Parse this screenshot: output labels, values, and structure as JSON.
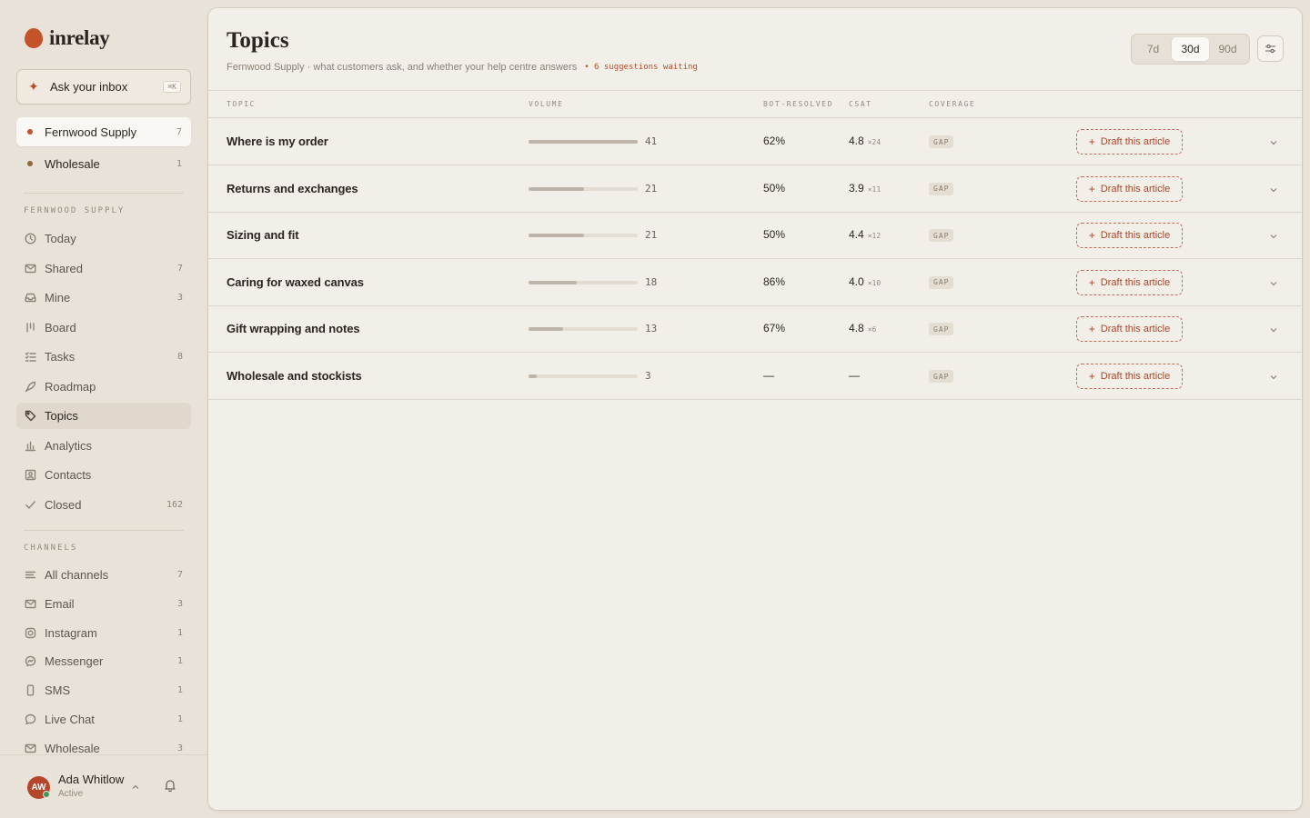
{
  "app": {
    "name": "inrelay"
  },
  "ask": {
    "label": "Ask your inbox",
    "shortcut": "⌘K"
  },
  "workspaces": [
    {
      "label": "Fernwood Supply",
      "count": "7",
      "color": "#c4532a",
      "active": true
    },
    {
      "label": "Wholesale",
      "count": "1",
      "color": "#8a6a3a",
      "active": false
    }
  ],
  "nav_section": "FERNWOOD SUPPLY",
  "nav": [
    {
      "label": "Today",
      "count": "",
      "icon": "clock-icon"
    },
    {
      "label": "Shared",
      "count": "7",
      "icon": "inbox-icon"
    },
    {
      "label": "Mine",
      "count": "3",
      "icon": "tray-icon"
    },
    {
      "label": "Board",
      "count": "",
      "icon": "kanban-icon"
    },
    {
      "label": "Tasks",
      "count": "8",
      "icon": "list-check-icon"
    },
    {
      "label": "Roadmap",
      "count": "",
      "icon": "rocket-icon"
    },
    {
      "label": "Topics",
      "count": "",
      "icon": "tag-icon",
      "active": true
    },
    {
      "label": "Analytics",
      "count": "",
      "icon": "bar-chart-icon"
    },
    {
      "label": "Contacts",
      "count": "",
      "icon": "contact-card-icon"
    },
    {
      "label": "Closed",
      "count": "162",
      "icon": "check-icon"
    }
  ],
  "channels_section": "CHANNELS",
  "channels": [
    {
      "label": "All channels",
      "count": "7",
      "icon": "lines-icon"
    },
    {
      "label": "Email",
      "count": "3",
      "icon": "mail-icon"
    },
    {
      "label": "Instagram",
      "count": "1",
      "icon": "instagram-icon"
    },
    {
      "label": "Messenger",
      "count": "1",
      "icon": "messenger-icon"
    },
    {
      "label": "SMS",
      "count": "1",
      "icon": "phone-icon"
    },
    {
      "label": "Live Chat",
      "count": "1",
      "icon": "chat-bubble-icon"
    },
    {
      "label": "Wholesale",
      "count": "3",
      "icon": "mail-icon"
    }
  ],
  "user": {
    "initials": "AW",
    "name": "Ada Whitlow",
    "status": "Active"
  },
  "page": {
    "title": "Topics",
    "subtitle": "Fernwood Supply · what customers ask, and whether your help centre answers",
    "suggestions": "• 6 suggestions waiting"
  },
  "ranges": [
    {
      "label": "7d",
      "active": false
    },
    {
      "label": "30d",
      "active": true
    },
    {
      "label": "90d",
      "active": false
    }
  ],
  "columns": {
    "topic": "TOPIC",
    "volume": "VOLUME",
    "bot": "BOT-RESOLVED",
    "csat": "CSAT",
    "coverage": "COVERAGE"
  },
  "volume_max": 41,
  "topics": [
    {
      "topic": "Where is my order",
      "volume": 41,
      "bot": "62%",
      "csat": "4.8",
      "csat_n": "×24",
      "coverage": "GAP",
      "action": "Draft this article"
    },
    {
      "topic": "Returns and exchanges",
      "volume": 21,
      "bot": "50%",
      "csat": "3.9",
      "csat_n": "×11",
      "coverage": "GAP",
      "action": "Draft this article"
    },
    {
      "topic": "Sizing and fit",
      "volume": 21,
      "bot": "50%",
      "csat": "4.4",
      "csat_n": "×12",
      "coverage": "GAP",
      "action": "Draft this article"
    },
    {
      "topic": "Caring for waxed canvas",
      "volume": 18,
      "bot": "86%",
      "csat": "4.0",
      "csat_n": "×10",
      "coverage": "GAP",
      "action": "Draft this article"
    },
    {
      "topic": "Gift wrapping and notes",
      "volume": 13,
      "bot": "67%",
      "csat": "4.8",
      "csat_n": "×6",
      "coverage": "GAP",
      "action": "Draft this article"
    },
    {
      "topic": "Wholesale and stockists",
      "volume": 3,
      "bot": "—",
      "csat": "—",
      "csat_n": "",
      "coverage": "GAP",
      "action": "Draft this article"
    }
  ]
}
